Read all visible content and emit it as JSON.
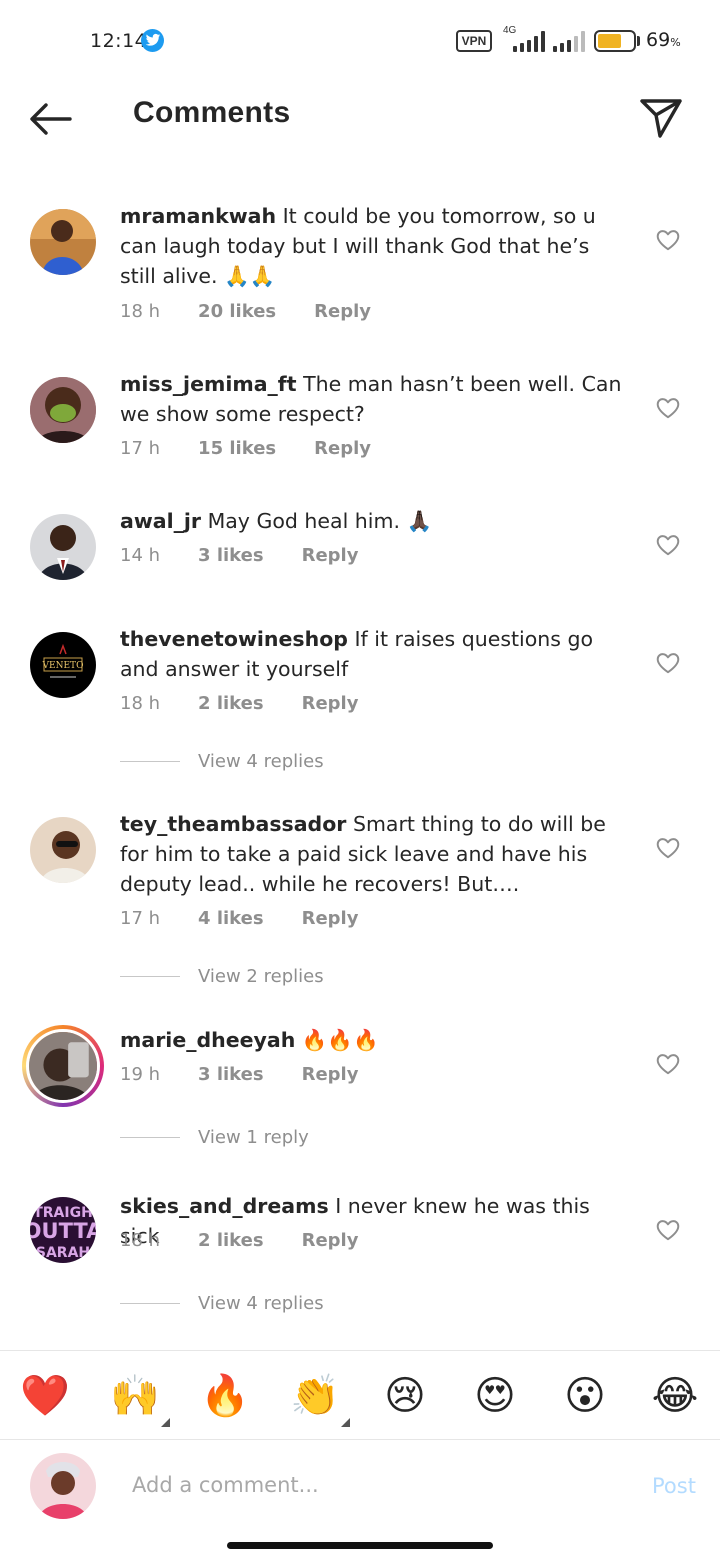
{
  "status_bar": {
    "time": "12:14",
    "vpn_label": "VPN",
    "network_label": "4G",
    "battery_percent": "69",
    "battery_unit": "%",
    "battery_level": 0.69,
    "battery_color": "#f0b323"
  },
  "header": {
    "title": "Comments",
    "back_icon": "arrow-left-icon",
    "share_icon": "paper-plane-icon"
  },
  "comments": [
    {
      "username": "mramankwah",
      "text": "It could be you tomorrow, so u can laugh today but I will thank God that he’s still alive. 🙏🙏",
      "time": "18 h",
      "likes": "20 likes",
      "reply": "Reply"
    },
    {
      "username": "miss_jemima_ft",
      "text": "The man hasn’t been well. Can we show some respect?",
      "time": "17 h",
      "likes": "15 likes",
      "reply": "Reply"
    },
    {
      "username": "awal_jr",
      "text": "May God heal him. 🙏🏿",
      "time": "14 h",
      "likes": "3 likes",
      "reply": "Reply"
    },
    {
      "username": "thevenetowineshop",
      "text": "If it raises questions go and answer it yourself",
      "time": "18 h",
      "likes": "2 likes",
      "reply": "Reply",
      "view_replies": "View 4 replies"
    },
    {
      "username": "tey_theambassador",
      "text": "Smart thing to do will be for him to take a paid sick leave and have his deputy lead.. while he recovers! But….",
      "time": "17 h",
      "likes": "4 likes",
      "reply": "Reply",
      "view_replies": "View 2 replies"
    },
    {
      "username": "marie_dheeyah",
      "text": "🔥🔥🔥",
      "time": "19 h",
      "likes": "3 likes",
      "reply": "Reply",
      "view_replies": "View 1 reply"
    },
    {
      "username": "skies_and_dreams",
      "text": "I never knew he was this sick",
      "time": "18 h",
      "likes": "2 likes",
      "reply": "Reply",
      "view_replies": "View 4 replies"
    }
  ],
  "avatars": {
    "venetto_logo_text": "VENETO",
    "straight_outta_text": [
      "TRAIGH",
      "OUTTA",
      "SARAH"
    ]
  },
  "emoji_bar": [
    "❤️",
    "🙌",
    "🔥",
    "👏",
    "😢",
    "😍",
    "😮",
    "😂"
  ],
  "composer": {
    "placeholder": "Add a comment...",
    "post_label": "Post",
    "post_color": "#b3dbff"
  }
}
